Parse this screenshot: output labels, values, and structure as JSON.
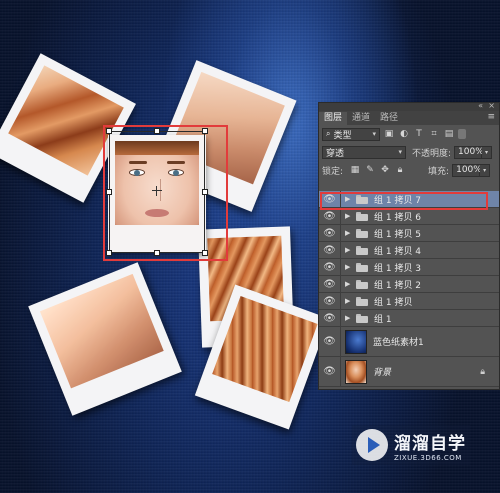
{
  "panel": {
    "tabs": [
      {
        "label": "图层"
      },
      {
        "label": "通道"
      },
      {
        "label": "路径"
      }
    ],
    "filter": {
      "label": "类型"
    },
    "blend_mode": {
      "value": "穿透"
    },
    "opacity": {
      "label": "不透明度:",
      "value": "100%"
    },
    "lock": {
      "label": "锁定:"
    },
    "fill": {
      "label": "填充:",
      "value": "100%"
    },
    "layers": [
      {
        "name": "组 1 拷贝 7",
        "type": "group",
        "selected": true
      },
      {
        "name": "组 1 拷贝 6",
        "type": "group"
      },
      {
        "name": "组 1 拷贝 5",
        "type": "group"
      },
      {
        "name": "组 1 拷贝 4",
        "type": "group"
      },
      {
        "name": "组 1 拷贝 3",
        "type": "group"
      },
      {
        "name": "组 1 拷贝 2",
        "type": "group"
      },
      {
        "name": "组 1 拷贝",
        "type": "group"
      },
      {
        "name": "组 1",
        "type": "group"
      },
      {
        "name": "蓝色纸素材1",
        "type": "image"
      },
      {
        "name": "背景",
        "type": "background",
        "locked": true
      }
    ]
  },
  "watermark": {
    "title": "溜溜自学",
    "subtitle": "ZIXUE.3D66.COM"
  },
  "colors": {
    "selection_highlight": "#e23b3b",
    "selected_layer": "#6f84a8",
    "panel_bg": "#535353"
  }
}
